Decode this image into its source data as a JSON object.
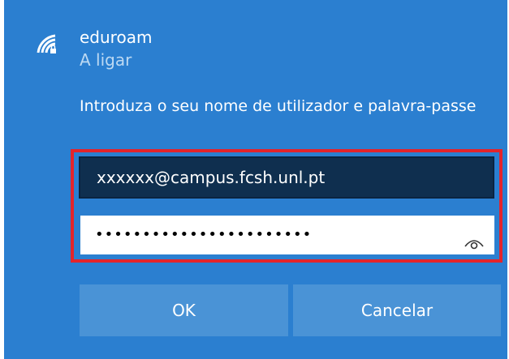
{
  "network": {
    "name": "eduroam",
    "status": "A ligar",
    "icon": "wifi-secure-icon"
  },
  "prompt": "Introduza o seu nome de utilizador e palavra-passe",
  "form": {
    "username_value": "xxxxxx@campus.fcsh.unl.pt",
    "password_value": "•••••••••••••••••••••••",
    "reveal_icon": "eye-icon"
  },
  "buttons": {
    "ok_label": "OK",
    "cancel_label": "Cancelar"
  },
  "colors": {
    "panel_background": "#2b7fd0",
    "highlight": "#e3242b",
    "username_field": "#0f2f4f",
    "button": "#4a93d6"
  }
}
